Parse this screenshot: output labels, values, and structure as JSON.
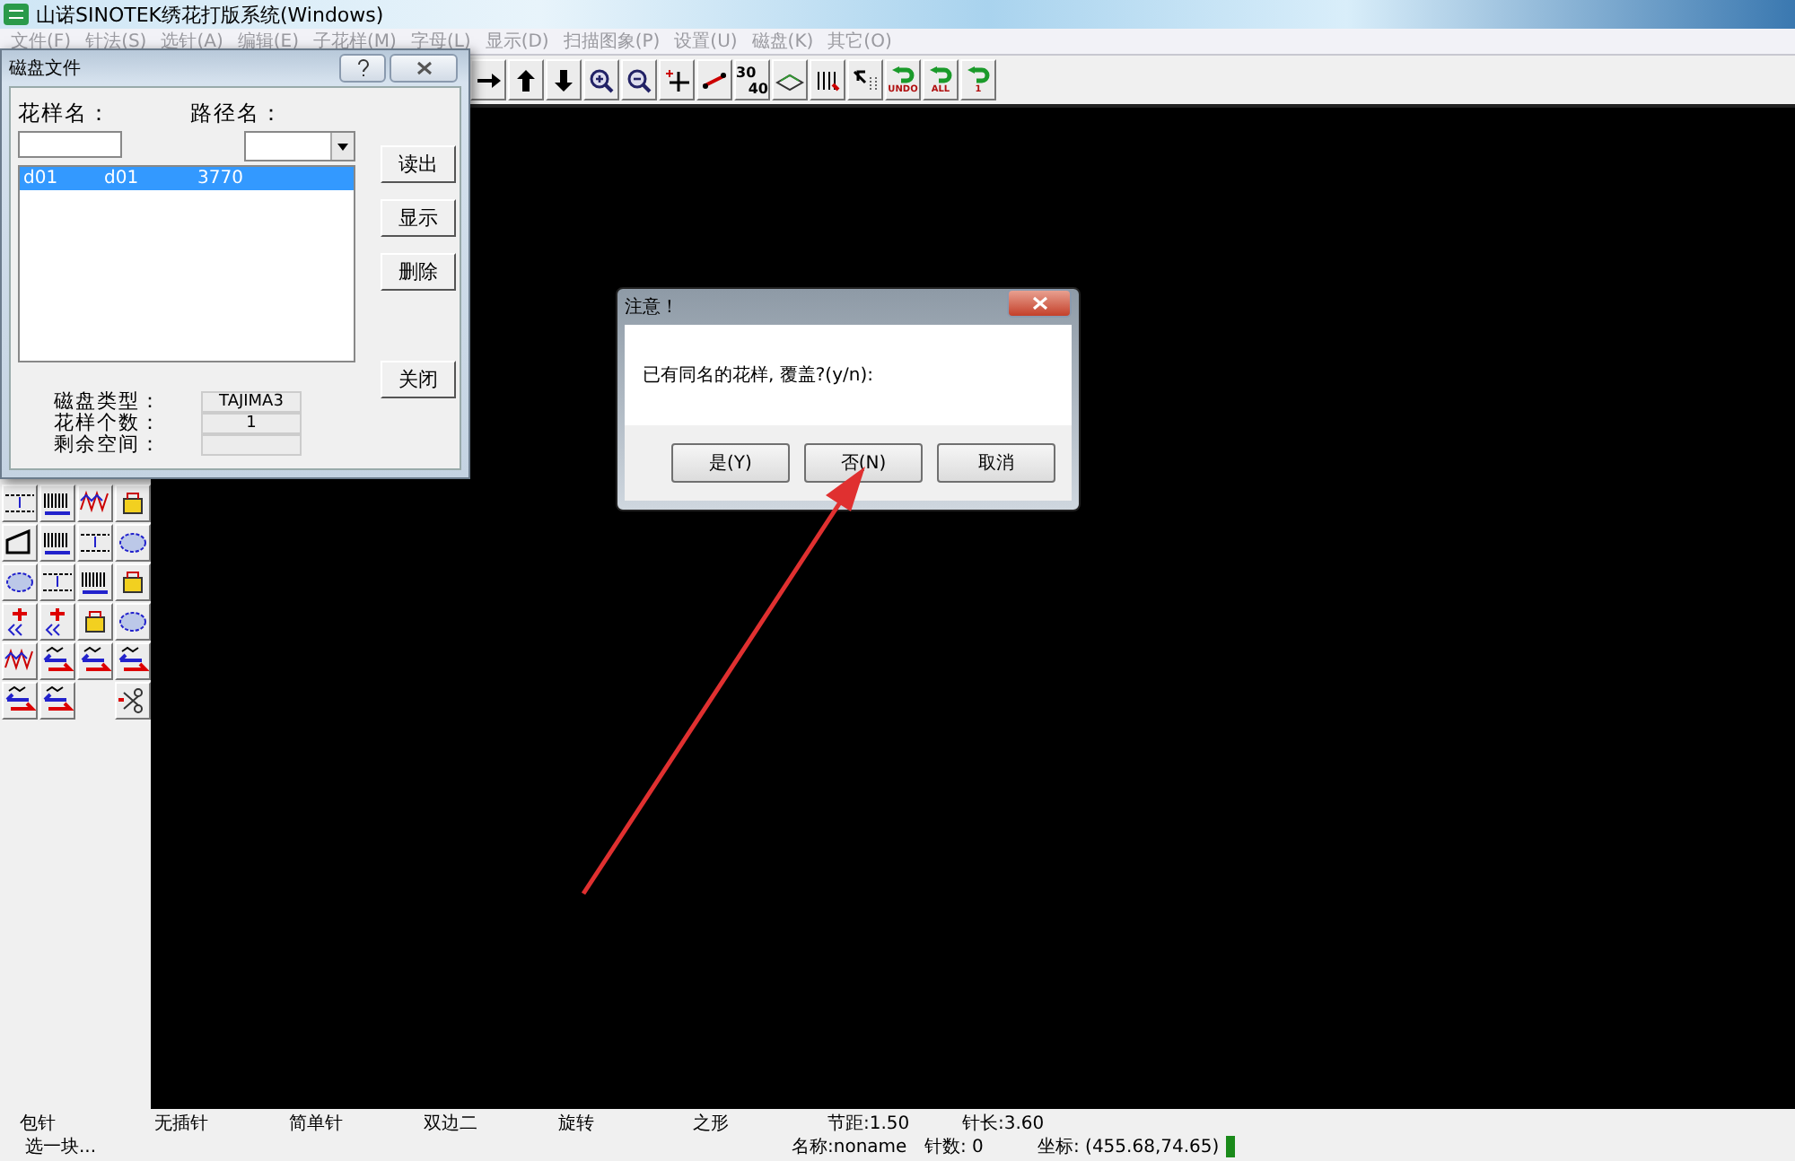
{
  "window": {
    "title": "山诺SINOTEK绣花打版系统(Windows)"
  },
  "menu": [
    {
      "label": "文件(F)",
      "disabled": true
    },
    {
      "label": "针法(S)",
      "disabled": true
    },
    {
      "label": "选针(A)",
      "disabled": true
    },
    {
      "label": "编辑(E)",
      "disabled": true
    },
    {
      "label": "子花样(M)",
      "disabled": true
    },
    {
      "label": "字母(L)",
      "disabled": true
    },
    {
      "label": "显示(D)",
      "disabled": true
    },
    {
      "label": "扫描图象(P)",
      "disabled": true
    },
    {
      "label": "设置(U)",
      "disabled": true
    },
    {
      "label": "磁盘(K)",
      "disabled": true
    },
    {
      "label": "其它(O)",
      "disabled": true
    }
  ],
  "toolbar": [
    {
      "kind": "arrow-right"
    },
    {
      "kind": "arrow-up"
    },
    {
      "kind": "arrow-down"
    },
    {
      "kind": "zoom-in"
    },
    {
      "kind": "zoom-out"
    },
    {
      "kind": "add-point"
    },
    {
      "kind": "line"
    },
    {
      "kind": "scale",
      "labels": [
        "30",
        "40"
      ]
    },
    {
      "kind": "layers"
    },
    {
      "kind": "stitches"
    },
    {
      "kind": "pointer"
    },
    {
      "kind": "undo",
      "labels": [
        "UNDO"
      ]
    },
    {
      "kind": "undo",
      "labels": [
        "ALL"
      ]
    },
    {
      "kind": "undo",
      "labels": [
        "1"
      ]
    }
  ],
  "palette": [
    {
      "kind": "run"
    },
    {
      "kind": "satin"
    },
    {
      "kind": "zigzag"
    },
    {
      "kind": "motif"
    },
    {
      "kind": "slant"
    },
    {
      "kind": "satin"
    },
    {
      "kind": "run"
    },
    {
      "kind": "fill"
    },
    {
      "kind": "fill"
    },
    {
      "kind": "run"
    },
    {
      "kind": "satin"
    },
    {
      "kind": "motif"
    },
    {
      "kind": "plus"
    },
    {
      "kind": "plus"
    },
    {
      "kind": "motif"
    },
    {
      "kind": "fill"
    },
    {
      "kind": "zigzag"
    },
    {
      "kind": "swap"
    },
    {
      "kind": "swap"
    },
    {
      "kind": "swap"
    },
    {
      "kind": "swap"
    },
    {
      "kind": "swap"
    },
    {
      "kind": "blank"
    },
    {
      "kind": "cut"
    }
  ],
  "disk_dialog": {
    "title": "磁盘文件",
    "pattern_name_label": "花样名：",
    "path_label": "路径名：",
    "files": [
      {
        "cells": [
          "d01",
          "d01",
          "3770"
        ],
        "selected": true
      }
    ],
    "buttons": [
      "读出",
      "显示",
      "删除"
    ],
    "close_button": "关闭",
    "info": [
      {
        "label": "磁盘类型：",
        "value": "TAJIMA3"
      },
      {
        "label": "花样个数：",
        "value": "1"
      },
      {
        "label": "剩余空间："
      }
    ]
  },
  "alert": {
    "title": "注意！",
    "message": "已有同名的花样, 覆盖?(y/n):",
    "buttons": [
      "是(Y)",
      "否(N)",
      "取消"
    ]
  },
  "status_bar": {
    "row_1": [
      "包针",
      "无插针",
      "简单针",
      "双边二",
      "旋转",
      "之形",
      "节距:1.50",
      "针长:3.60"
    ],
    "row_2": {
      "hint": "选一块...",
      "name": "名称:noname",
      "count": "针数: 0",
      "coords": "坐标: (455.68,74.65)"
    }
  }
}
